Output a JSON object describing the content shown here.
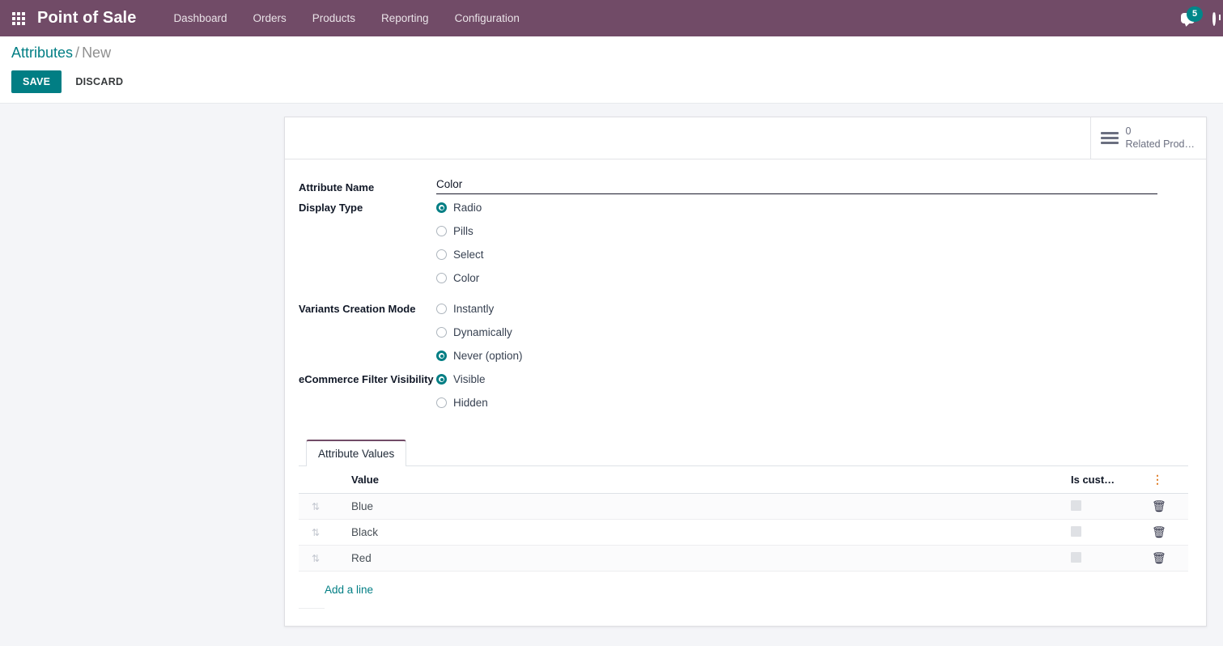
{
  "navbar": {
    "apps_icon": "apps-grid-icon",
    "brand": "Point of Sale",
    "items": [
      {
        "label": "Dashboard"
      },
      {
        "label": "Orders"
      },
      {
        "label": "Products"
      },
      {
        "label": "Reporting"
      },
      {
        "label": "Configuration"
      }
    ],
    "messages_icon": "chat-bubble-icon",
    "messages_count": "5",
    "activities_icon": "clock-icon",
    "brand_color": "#714B67"
  },
  "control_panel": {
    "breadcrumb_root": "Attributes",
    "breadcrumb_sep": "/",
    "breadcrumb_current": "New",
    "save_label": "SAVE",
    "discard_label": "DISCARD",
    "accent_color": "#017e84"
  },
  "sheet": {
    "stat_button": {
      "icon": "list-lines-icon",
      "value": "0",
      "label": "Related Prod…"
    },
    "fields": {
      "attribute_name": {
        "label": "Attribute Name",
        "value": "Color",
        "placeholder": ""
      },
      "display_type": {
        "label": "Display Type",
        "options": [
          {
            "label": "Radio",
            "selected": true
          },
          {
            "label": "Pills",
            "selected": false
          },
          {
            "label": "Select",
            "selected": false
          },
          {
            "label": "Color",
            "selected": false
          }
        ]
      },
      "variants_creation_mode": {
        "label": "Variants Creation Mode",
        "options": [
          {
            "label": "Instantly",
            "selected": false
          },
          {
            "label": "Dynamically",
            "selected": false
          },
          {
            "label": "Never (option)",
            "selected": true
          }
        ]
      },
      "ecommerce_filter_visibility": {
        "label": "eCommerce Filter Visibility",
        "options": [
          {
            "label": "Visible",
            "selected": true
          },
          {
            "label": "Hidden",
            "selected": false
          }
        ]
      }
    },
    "notebook": {
      "tabs": [
        {
          "label": "Attribute Values",
          "active": true
        }
      ],
      "table": {
        "headers": {
          "value": "Value",
          "is_custom": "Is cust…",
          "optional_toggle_icon": "vertical-dots-icon"
        },
        "rows": [
          {
            "handle_icon": "drag-handle-icon",
            "value": "Blue",
            "is_custom": false,
            "delete_icon": "trash-icon"
          },
          {
            "handle_icon": "drag-handle-icon",
            "value": "Black",
            "is_custom": false,
            "delete_icon": "trash-icon"
          },
          {
            "handle_icon": "drag-handle-icon",
            "value": "Red",
            "is_custom": false,
            "delete_icon": "trash-icon"
          }
        ],
        "add_line_label": "Add a line"
      }
    }
  }
}
